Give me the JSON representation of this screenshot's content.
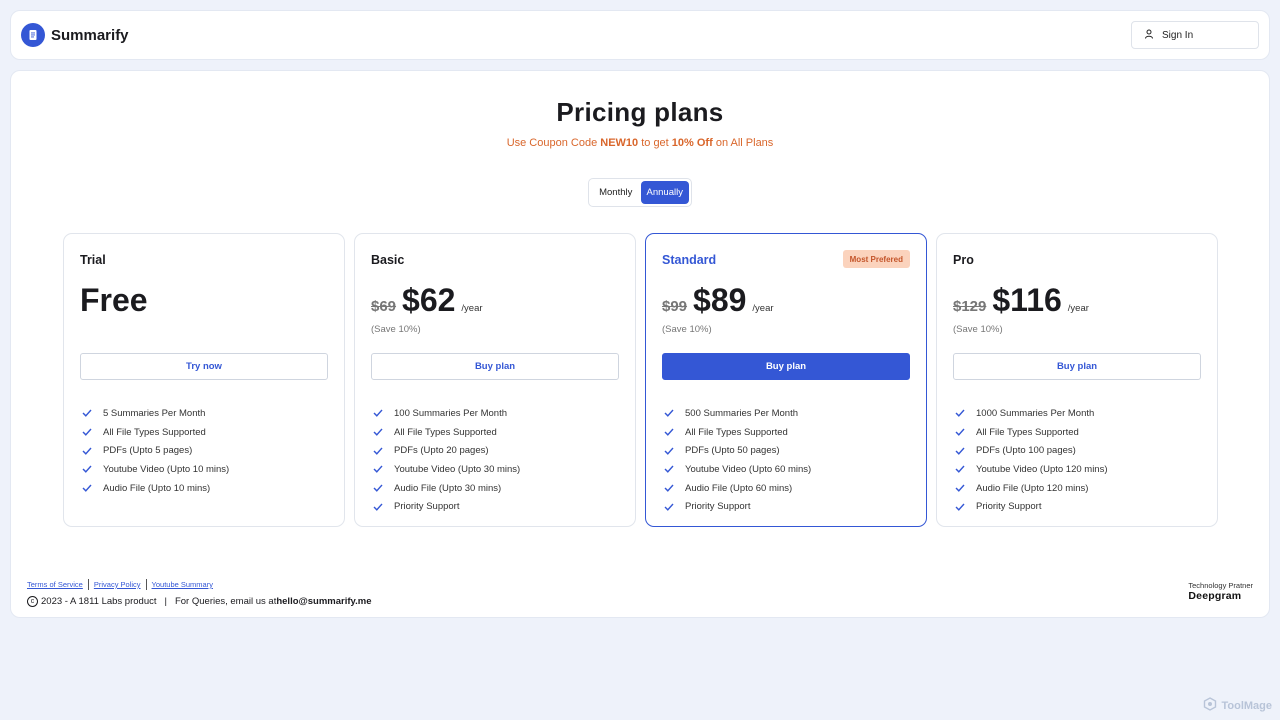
{
  "header": {
    "brand_name": "Summarify",
    "signin_label": "Sign In"
  },
  "pricing": {
    "title": "Pricing plans",
    "coupon_prefix": "Use Coupon Code ",
    "coupon_code": "NEW10",
    "coupon_mid": " to get ",
    "coupon_discount": "10% Off",
    "coupon_suffix": " on All Plans"
  },
  "billing_toggle": {
    "monthly": "Monthly",
    "annually": "Annually",
    "selected": "Annually"
  },
  "plans": [
    {
      "name": "Trial",
      "old_price": "",
      "price": "Free",
      "per": "",
      "save": "",
      "button": "Try now",
      "features": [
        "5 Summaries Per Month",
        "All File Types Supported",
        "PDFs (Upto 5 pages)",
        "Youtube Video (Upto 10 mins)",
        "Audio File (Upto 10 mins)"
      ]
    },
    {
      "name": "Basic",
      "old_price": "$69",
      "price": "$62",
      "per": "/year",
      "save": "(Save 10%)",
      "button": "Buy plan",
      "features": [
        "100 Summaries Per Month",
        "All File Types Supported",
        "PDFs (Upto 20 pages)",
        "Youtube Video (Upto 30 mins)",
        "Audio File (Upto 30 mins)",
        "Priority Support"
      ]
    },
    {
      "name": "Standard",
      "badge": "Most Prefered",
      "old_price": "$99",
      "price": "$89",
      "per": "/year",
      "save": "(Save 10%)",
      "button": "Buy plan",
      "features": [
        "500 Summaries Per Month",
        "All File Types Supported",
        "PDFs (Upto 50 pages)",
        "Youtube Video (Upto 60 mins)",
        "Audio File (Upto 60 mins)",
        "Priority Support"
      ]
    },
    {
      "name": "Pro",
      "old_price": "$129",
      "price": "$116",
      "per": "/year",
      "save": "(Save 10%)",
      "button": "Buy plan",
      "features": [
        "1000 Summaries Per Month",
        "All File Types Supported",
        "PDFs (Upto 100 pages)",
        "Youtube Video (Upto 120 mins)",
        "Audio File (Upto 120 mins)",
        "Priority Support"
      ]
    }
  ],
  "footer": {
    "links": [
      "Terms of Service",
      "Privacy Policy",
      "Youtube Summary"
    ],
    "copyright": "2023 - A 1811 Labs product",
    "queries_prefix": "For Queries, email us at ",
    "email": "hello@summarify.me",
    "tech_label": "Technology Pratner",
    "tech_name": "Deepgram"
  },
  "watermark": "ToolMage",
  "colors": {
    "accent": "#3457d5",
    "coupon": "#d9662b",
    "badge_bg": "#fbd3bd",
    "background": "#eef2fa"
  }
}
